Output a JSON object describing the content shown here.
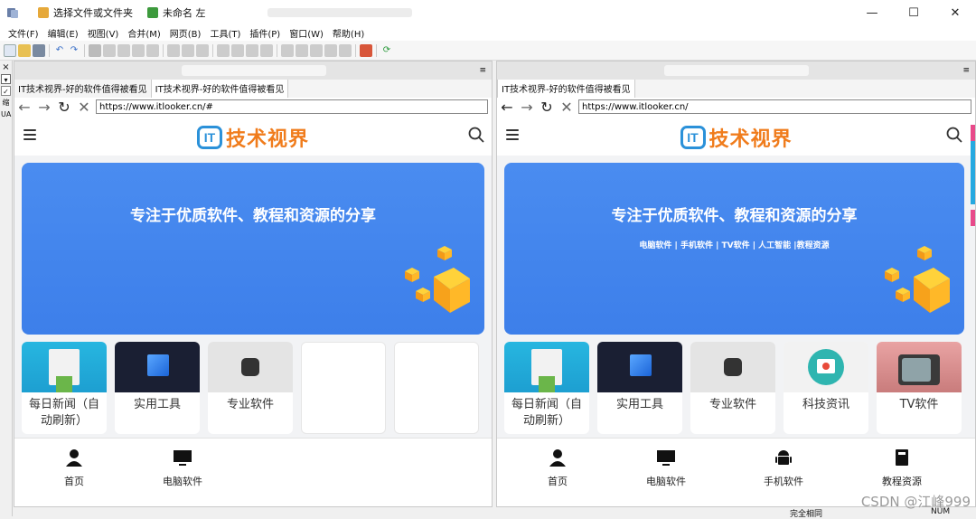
{
  "window": {
    "tabs": [
      {
        "label": "选择文件或文件夹",
        "icon": "folder-compare-icon"
      },
      {
        "label": "未命名 左",
        "icon": "green-check-icon"
      }
    ],
    "controls": {
      "minimize": "—",
      "maximize": "☐",
      "close": "✕"
    }
  },
  "menu": [
    "文件(F)",
    "编辑(E)",
    "视图(V)",
    "合并(M)",
    "网页(B)",
    "工具(T)",
    "插件(P)",
    "窗口(W)",
    "帮助(H)"
  ],
  "left_strip": {
    "close": "×",
    "label1": "缩",
    "label2": "UA"
  },
  "pane_header_glyph": "≡",
  "left_pane": {
    "tabs": [
      "IT技术视界-好的软件值得被看见",
      "IT技术视界-好的软件值得被看见"
    ],
    "url": "https://www.itlooker.cn/#",
    "site": {
      "logo_mark": "IT",
      "logo_text": "技术视界",
      "banner_headline": "专注于优质软件、教程和资源的分享",
      "banner_sub": "",
      "categories": [
        "每日新闻（自动刷新）",
        "实用工具",
        "专业软件",
        "",
        ""
      ],
      "bottom_nav": [
        "首页",
        "电脑软件"
      ]
    }
  },
  "right_pane": {
    "tabs": [
      "IT技术视界-好的软件值得被看见"
    ],
    "url": "https://www.itlooker.cn/",
    "site": {
      "logo_mark": "IT",
      "logo_text": "技术视界",
      "banner_headline": "专注于优质软件、教程和资源的分享",
      "banner_sub": "电脑软件 | 手机软件 | TV软件 | 人工智能 |教程资源",
      "categories": [
        "每日新闻（自动刷新）",
        "实用工具",
        "专业软件",
        "科技资讯",
        "TV软件"
      ],
      "bottom_nav": [
        "首页",
        "电脑软件",
        "手机软件",
        "教程资源"
      ]
    }
  },
  "status": {
    "left": "完全相同",
    "right": "NUM"
  },
  "watermark": "CSDN @江峰999",
  "colors": {
    "brand_blue": "#2b91d9",
    "brand_orange": "#f07c1c",
    "banner": "#4a8cf0"
  }
}
